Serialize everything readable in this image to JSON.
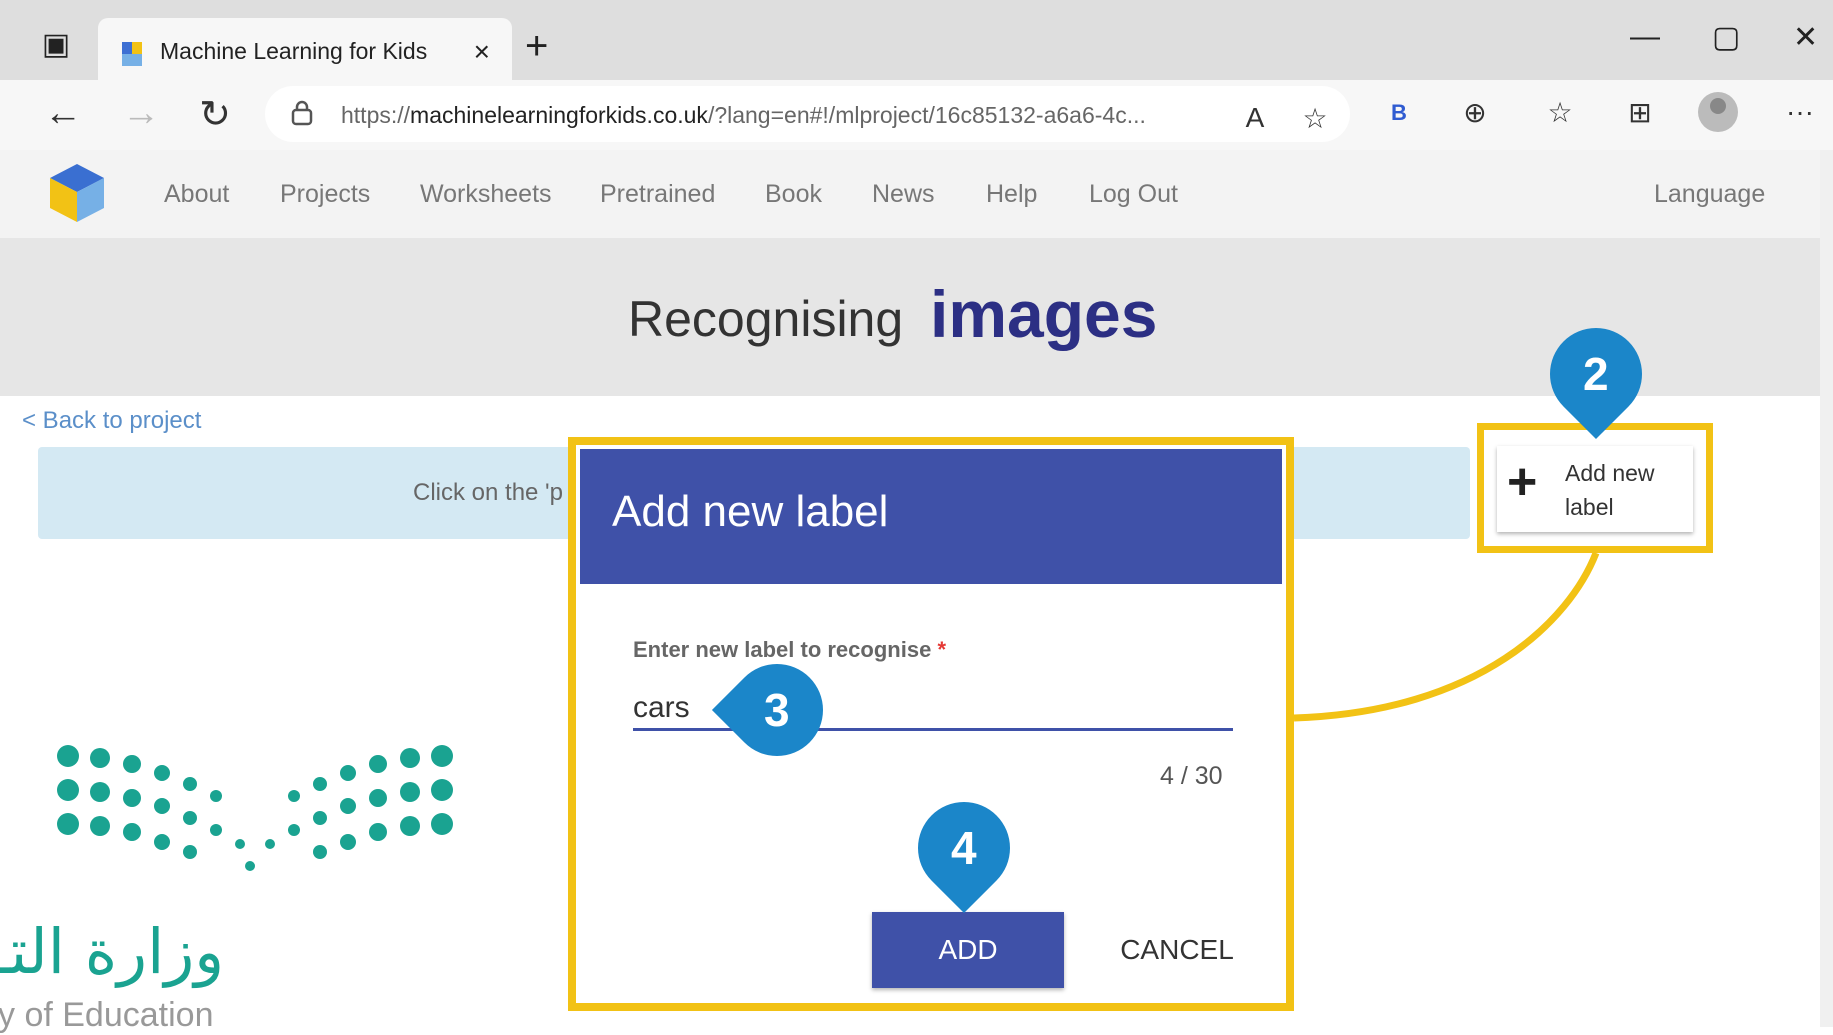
{
  "browser": {
    "tab_title": "Machine Learning for Kids",
    "url_prefix": "https://",
    "url_domain": "machinelearningforkids.co.uk",
    "url_rest": "/?lang=en#!/mlproject/16c85132-a6a6-4c...",
    "icons": {
      "close_tab": "×",
      "new_tab": "+",
      "minimize": "—",
      "maximize": "▢",
      "close_window": "✕",
      "back": "←",
      "forward": "→",
      "refresh": "↻",
      "read_aloud": "A",
      "favorites_add": "☆",
      "bing": "B",
      "extensions": "⊕",
      "favorites": "☆",
      "collections": "⊞",
      "more": "···"
    }
  },
  "site": {
    "nav": [
      "About",
      "Projects",
      "Worksheets",
      "Pretrained",
      "Book",
      "News",
      "Help",
      "Log Out"
    ],
    "language": "Language",
    "title_light": "Recognising",
    "title_bold": "images",
    "back_link": "< Back to project",
    "info_text": "Click on the 'p",
    "add_label_plus": "+",
    "add_label_button": "Add new label"
  },
  "dialog": {
    "title": "Add new label",
    "field_label": "Enter new label to recognise",
    "required_mark": "*",
    "input_value": "cars",
    "char_count": "4 / 30",
    "add_button": "ADD",
    "cancel_button": "CANCEL"
  },
  "callouts": [
    "2",
    "3",
    "4"
  ],
  "watermark": {
    "arabic": "وزارة التـ",
    "english": "y of Education"
  },
  "colors": {
    "dialog_header": "#3f51a8",
    "highlight": "#f2c215",
    "callout": "#1b86c9",
    "title_bold": "#2c2f84",
    "info_bar": "#d4e9f3",
    "watermark": "#1aa391"
  }
}
